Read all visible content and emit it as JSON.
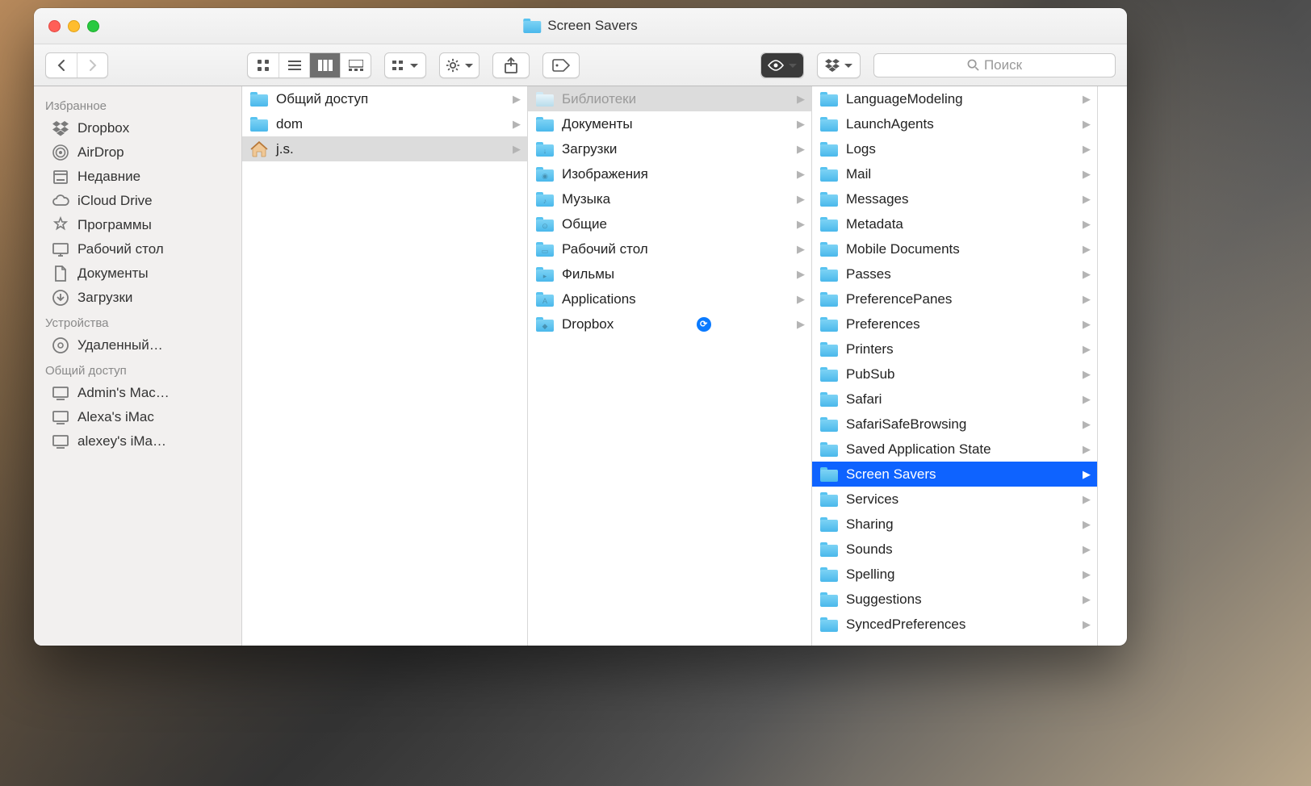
{
  "window_title": "Screen Savers",
  "search_placeholder": "Поиск",
  "sidebar": {
    "sections": [
      {
        "title": "Избранное",
        "items": [
          {
            "label": "Dropbox",
            "icon": "dropbox"
          },
          {
            "label": "AirDrop",
            "icon": "airdrop"
          },
          {
            "label": "Недавние",
            "icon": "recents"
          },
          {
            "label": "iCloud Drive",
            "icon": "icloud"
          },
          {
            "label": "Программы",
            "icon": "apps"
          },
          {
            "label": "Рабочий стол",
            "icon": "desktop"
          },
          {
            "label": "Документы",
            "icon": "documents"
          },
          {
            "label": "Загрузки",
            "icon": "downloads"
          }
        ]
      },
      {
        "title": "Устройства",
        "items": [
          {
            "label": "Удаленный…",
            "icon": "disc"
          }
        ]
      },
      {
        "title": "Общий доступ",
        "items": [
          {
            "label": "Admin's Mac…",
            "icon": "computer"
          },
          {
            "label": "Alexa's iMac",
            "icon": "computer"
          },
          {
            "label": "alexey's iMa…",
            "icon": "computer"
          }
        ]
      }
    ]
  },
  "columns": [
    {
      "items": [
        {
          "label": "Общий доступ",
          "icon": "folder",
          "selected": false
        },
        {
          "label": "dom",
          "icon": "folder",
          "selected": false
        },
        {
          "label": "j.s.",
          "icon": "home",
          "selected": "gray"
        }
      ]
    },
    {
      "items": [
        {
          "label": "Библиотеки",
          "icon": "folder-faded",
          "selected": "gray",
          "faded": true
        },
        {
          "label": "Документы",
          "icon": "folder",
          "selected": false
        },
        {
          "label": "Загрузки",
          "icon": "folder-dl",
          "selected": false
        },
        {
          "label": "Изображения",
          "icon": "folder-img",
          "selected": false
        },
        {
          "label": "Музыка",
          "icon": "folder-music",
          "selected": false
        },
        {
          "label": "Общие",
          "icon": "folder-pub",
          "selected": false
        },
        {
          "label": "Рабочий стол",
          "icon": "folder-desk",
          "selected": false
        },
        {
          "label": "Фильмы",
          "icon": "folder-mov",
          "selected": false
        },
        {
          "label": "Applications",
          "icon": "folder-app",
          "selected": false
        },
        {
          "label": "Dropbox",
          "icon": "folder-dropbox",
          "selected": false,
          "sync": true
        }
      ]
    },
    {
      "items": [
        {
          "label": "LanguageModeling",
          "icon": "folder"
        },
        {
          "label": "LaunchAgents",
          "icon": "folder"
        },
        {
          "label": "Logs",
          "icon": "folder"
        },
        {
          "label": "Mail",
          "icon": "folder"
        },
        {
          "label": "Messages",
          "icon": "folder"
        },
        {
          "label": "Metadata",
          "icon": "folder"
        },
        {
          "label": "Mobile Documents",
          "icon": "folder"
        },
        {
          "label": "Passes",
          "icon": "folder"
        },
        {
          "label": "PreferencePanes",
          "icon": "folder"
        },
        {
          "label": "Preferences",
          "icon": "folder"
        },
        {
          "label": "Printers",
          "icon": "folder"
        },
        {
          "label": "PubSub",
          "icon": "folder"
        },
        {
          "label": "Safari",
          "icon": "folder"
        },
        {
          "label": "SafariSafeBrowsing",
          "icon": "folder"
        },
        {
          "label": "Saved Application State",
          "icon": "folder"
        },
        {
          "label": "Screen Savers",
          "icon": "folder",
          "selected": "blue"
        },
        {
          "label": "Services",
          "icon": "folder"
        },
        {
          "label": "Sharing",
          "icon": "folder"
        },
        {
          "label": "Sounds",
          "icon": "folder"
        },
        {
          "label": "Spelling",
          "icon": "folder"
        },
        {
          "label": "Suggestions",
          "icon": "folder"
        },
        {
          "label": "SyncedPreferences",
          "icon": "folder"
        }
      ]
    }
  ]
}
